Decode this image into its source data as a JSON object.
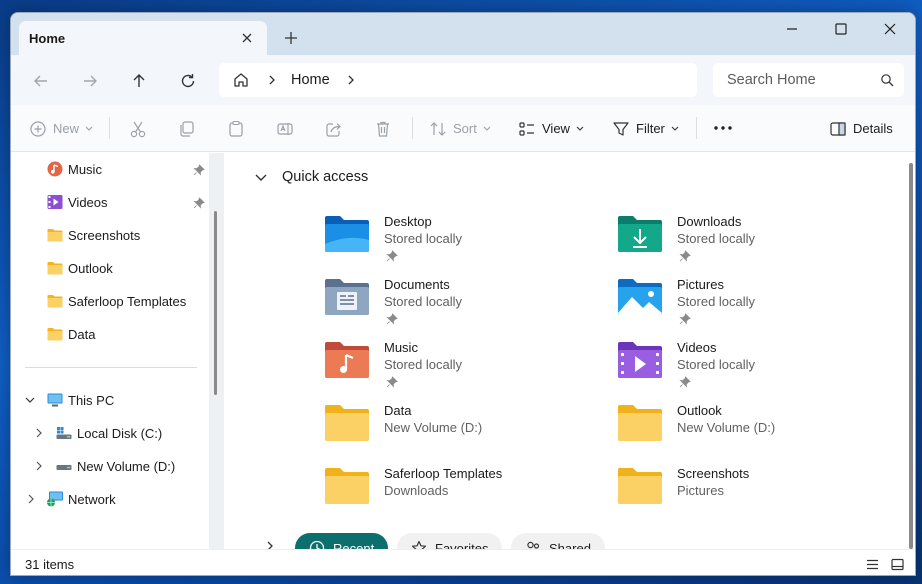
{
  "window": {
    "tab_title": "Home"
  },
  "address": {
    "path": [
      "Home"
    ],
    "search_placeholder": "Search Home"
  },
  "toolbar": {
    "new_label": "New",
    "sort_label": "Sort",
    "view_label": "View",
    "filter_label": "Filter",
    "details_label": "Details"
  },
  "sidebar": {
    "pinned": [
      {
        "label": "Music",
        "icon": "music-folder-icon",
        "pinned": true
      },
      {
        "label": "Videos",
        "icon": "videos-folder-icon",
        "pinned": true
      },
      {
        "label": "Screenshots",
        "icon": "folder-icon",
        "pinned": false
      },
      {
        "label": "Outlook",
        "icon": "folder-icon",
        "pinned": false
      },
      {
        "label": "Saferloop Templates",
        "icon": "folder-icon",
        "pinned": false
      },
      {
        "label": "Data",
        "icon": "folder-icon",
        "pinned": false
      }
    ],
    "this_pc": "This PC",
    "drives": [
      {
        "label": "Local Disk (C:)"
      },
      {
        "label": "New Volume (D:)"
      }
    ],
    "network": "Network"
  },
  "quick_access": {
    "title": "Quick access",
    "items": [
      {
        "name": "Desktop",
        "sub": "Stored locally",
        "icon": "desktop-folder-icon",
        "pinned": true
      },
      {
        "name": "Downloads",
        "sub": "Stored locally",
        "icon": "downloads-folder-icon",
        "pinned": true
      },
      {
        "name": "Documents",
        "sub": "Stored locally",
        "icon": "documents-folder-icon",
        "pinned": true
      },
      {
        "name": "Pictures",
        "sub": "Stored locally",
        "icon": "pictures-folder-icon",
        "pinned": true
      },
      {
        "name": "Music",
        "sub": "Stored locally",
        "icon": "music-folder-icon",
        "pinned": true
      },
      {
        "name": "Videos",
        "sub": "Stored locally",
        "icon": "videos-folder-icon",
        "pinned": true
      },
      {
        "name": "Data",
        "sub": "New Volume (D:)",
        "icon": "folder-icon",
        "pinned": false
      },
      {
        "name": "Outlook",
        "sub": "New Volume (D:)",
        "icon": "folder-icon",
        "pinned": false
      },
      {
        "name": "Saferloop Templates",
        "sub": "Downloads",
        "icon": "folder-icon",
        "pinned": false
      },
      {
        "name": "Screenshots",
        "sub": "Pictures",
        "icon": "folder-icon",
        "pinned": false
      }
    ]
  },
  "chips": [
    {
      "label": "Recent",
      "active": true
    },
    {
      "label": "Favorites",
      "active": false
    },
    {
      "label": "Shared",
      "active": false
    }
  ],
  "status": {
    "item_count": "31 items"
  },
  "colors": {
    "accent": "#0d6e6e",
    "folder_yellow": "#f8c94a",
    "titlebar": "#d3e0ee"
  }
}
